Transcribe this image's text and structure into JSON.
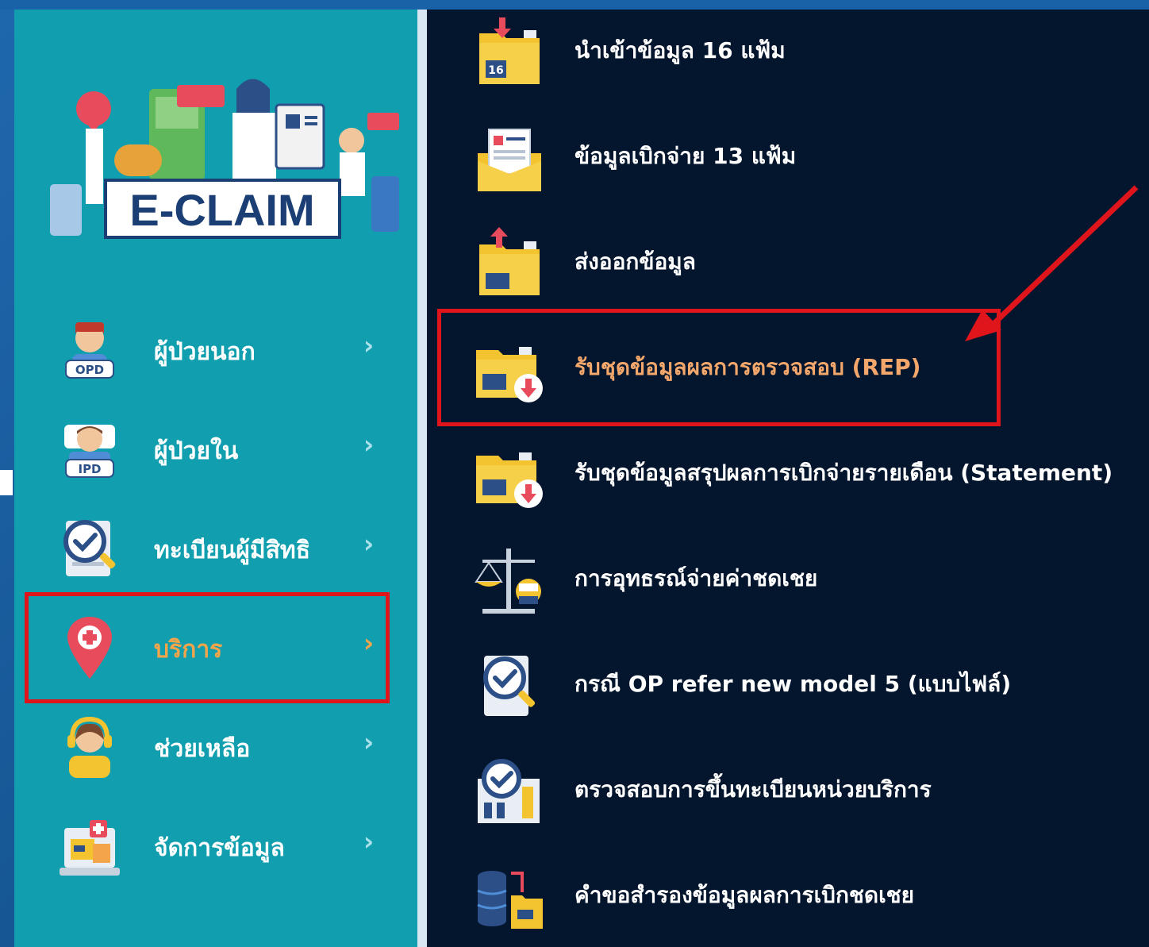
{
  "logo": {
    "text": "E-CLAIM"
  },
  "sidebar": {
    "items": [
      {
        "label": "ผู้ป่วยนอก",
        "badge": "OPD",
        "chevron": "›"
      },
      {
        "label": "ผู้ป่วยใน",
        "badge": "IPD",
        "chevron": "›"
      },
      {
        "label": "ทะเบียนผู้มีสิทธิ",
        "chevron": "›"
      },
      {
        "label": "บริการ",
        "chevron": "›"
      },
      {
        "label": "ช่วยเหลือ",
        "chevron": "›"
      },
      {
        "label": "จัดการข้อมูล",
        "chevron": "›"
      }
    ]
  },
  "menu": {
    "items": [
      {
        "label": "นำเข้าข้อมูล 16 แฟ้ม",
        "icon_text": "16"
      },
      {
        "label": "ข้อมูลเบิกจ่าย 13 แฟ้ม"
      },
      {
        "label": "ส่งออกข้อมูล"
      },
      {
        "label": "รับชุดข้อมูลผลการตรวจสอบ (REP)"
      },
      {
        "label": "รับชุดข้อมูลสรุปผลการเบิกจ่ายรายเดือน (Statement)"
      },
      {
        "label": "การอุทธรณ์จ่ายค่าชดเชย"
      },
      {
        "label": "กรณี OP refer new model 5 (แบบไฟล์)"
      },
      {
        "label": "ตรวจสอบการขึ้นทะเบียนหน่วยบริการ"
      },
      {
        "label": "คำขอสำรองข้อมูลผลการเบิกชดเชย"
      }
    ]
  },
  "colors": {
    "sidebar_bg": "#119faf",
    "main_bg": "#04162e",
    "highlight_red": "#e0141b",
    "active_orange": "#f4a54a"
  }
}
